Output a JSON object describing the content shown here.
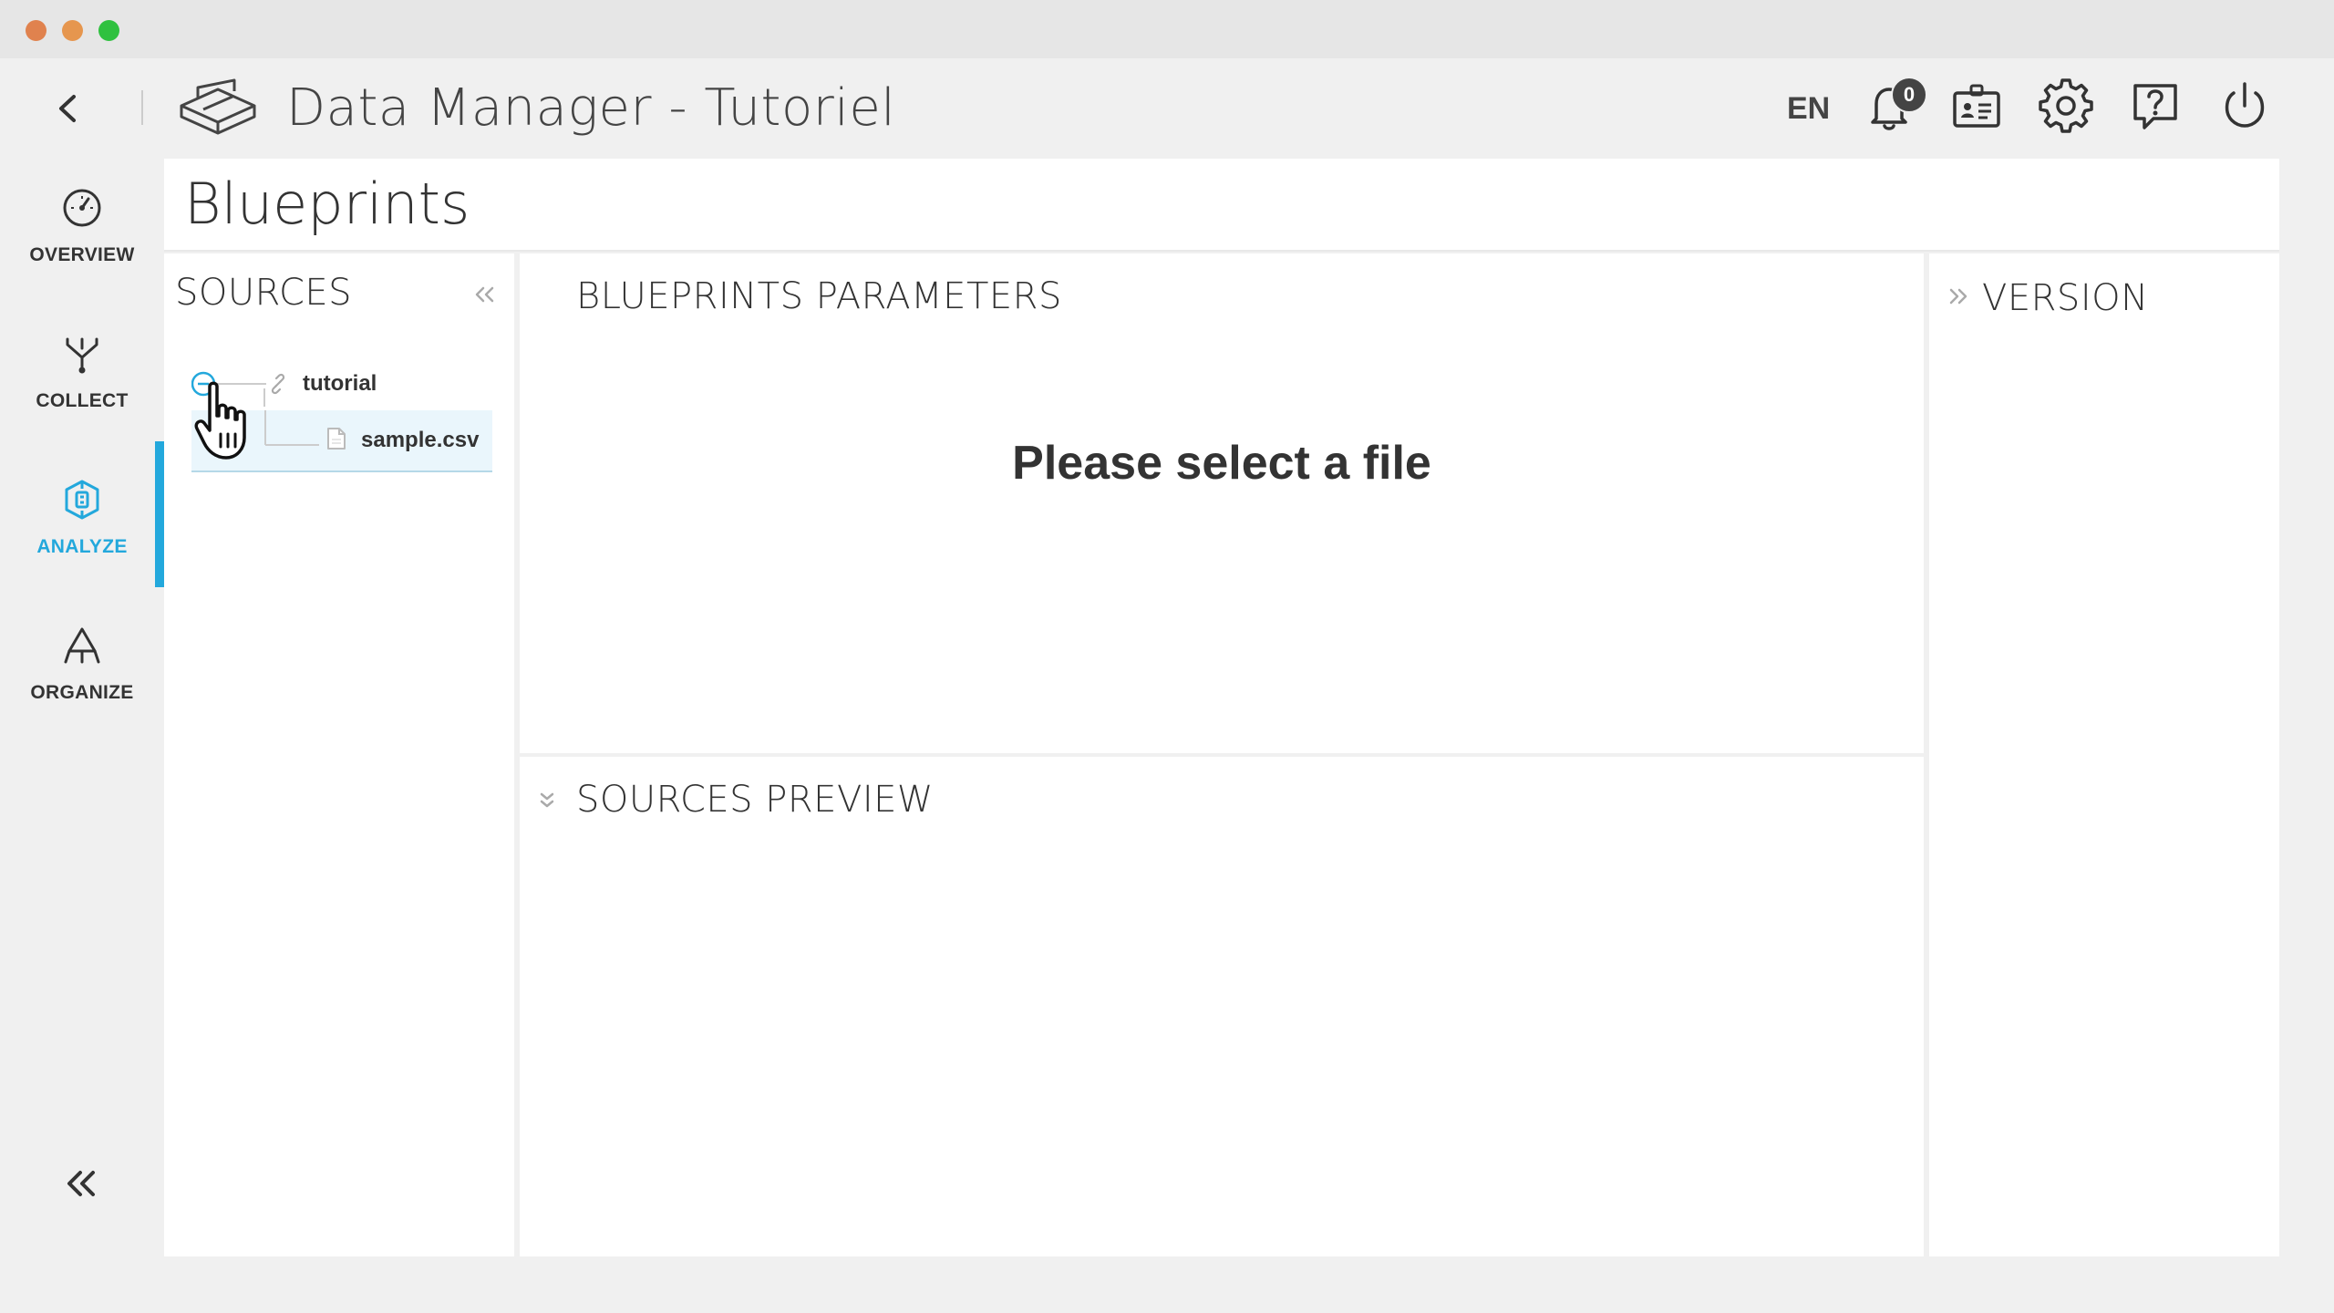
{
  "app": {
    "title": "Data Manager - Tutoriel",
    "language": "EN",
    "notification_count": "0"
  },
  "icons": {
    "back": "chevron-left-icon",
    "logo": "box-logo-icon",
    "notifications": "bell-icon",
    "profile": "id-card-icon",
    "settings": "gear-icon",
    "help": "help-bubble-icon",
    "power": "power-icon"
  },
  "nav": {
    "items": [
      {
        "label": "OVERVIEW",
        "icon": "gauge-icon",
        "active": false
      },
      {
        "label": "COLLECT",
        "icon": "funnel-merge-icon",
        "active": false
      },
      {
        "label": "ANALYZE",
        "icon": "analyze-icon",
        "active": true
      },
      {
        "label": "ORGANIZE",
        "icon": "hierarchy-icon",
        "active": false
      }
    ],
    "collapse_icon": "double-chevron-left-icon"
  },
  "page": {
    "title": "Blueprints"
  },
  "sources": {
    "title": "SOURCES",
    "tree": {
      "root": {
        "label": "tutorial",
        "icon": "link-icon",
        "expanded": true
      },
      "children": [
        {
          "label": "sample.csv",
          "icon": "file-icon",
          "selected": true
        }
      ]
    }
  },
  "params": {
    "title": "BLUEPRINTS PARAMETERS",
    "empty_message": "Please select a file"
  },
  "preview": {
    "title": "SOURCES PREVIEW"
  },
  "version": {
    "title": "VERSION"
  },
  "colors": {
    "accent": "#23a8dc",
    "background": "#f0f0f0",
    "panel": "#ffffff",
    "text": "#333333"
  }
}
